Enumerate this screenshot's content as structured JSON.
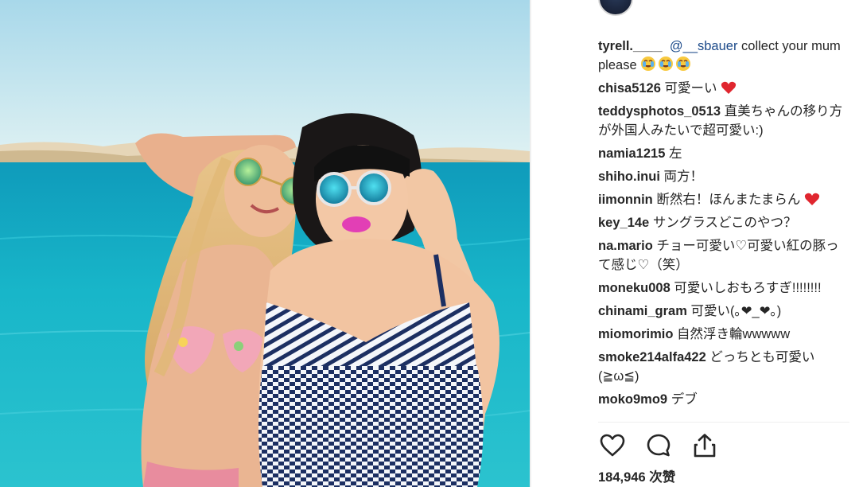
{
  "post": {
    "likes_count": "184,946",
    "likes_suffix": "次赞"
  },
  "comments": [
    {
      "user": "tyrell.____",
      "mention": "@__sbauer",
      "text": " collect your mum please",
      "emoji": "crying-laughing-emoji x3"
    },
    {
      "user": "chisa5126",
      "text": "可愛ーい",
      "emoji": "red-heart-emoji"
    },
    {
      "user": "teddysphotos_0513",
      "text": "直美ちゃんの移り方が外国人みたいで超可愛い:)"
    },
    {
      "user": "namia1215",
      "text": "左"
    },
    {
      "user": "shiho.inui",
      "text": "両方！"
    },
    {
      "user": "iimonnin",
      "text": "断然右！ほんまたまらん",
      "emoji": "red-heart-emoji"
    },
    {
      "user": "key_14e",
      "text": "サングラスどこのやつ？"
    },
    {
      "user": "na.mario",
      "text": "チョー可愛い♡可愛い紅の豚って感じ♡（笑）"
    },
    {
      "user": "moneku008",
      "text": "可愛いしおもろすぎ!!!!!!!!"
    },
    {
      "user": "chinami_gram",
      "text": "可愛い(｡❤︎_❤︎｡)"
    },
    {
      "user": "miomorimio",
      "text": "自然浮き輪wwwww"
    },
    {
      "user": "smoke214alfa422",
      "text": "どっちとも可愛い(≧ω≦)"
    },
    {
      "user": "moko9mo9",
      "text": "デブ"
    }
  ],
  "icons": {
    "like": "heart-outline-icon",
    "comment": "comment-bubble-icon",
    "share": "share-upload-icon"
  },
  "colors": {
    "text": "#262626",
    "mention": "#1c4a8a",
    "heart_emoji": "#e0262f",
    "sea": "#18b6c9",
    "sky": "#bfe6f0"
  }
}
